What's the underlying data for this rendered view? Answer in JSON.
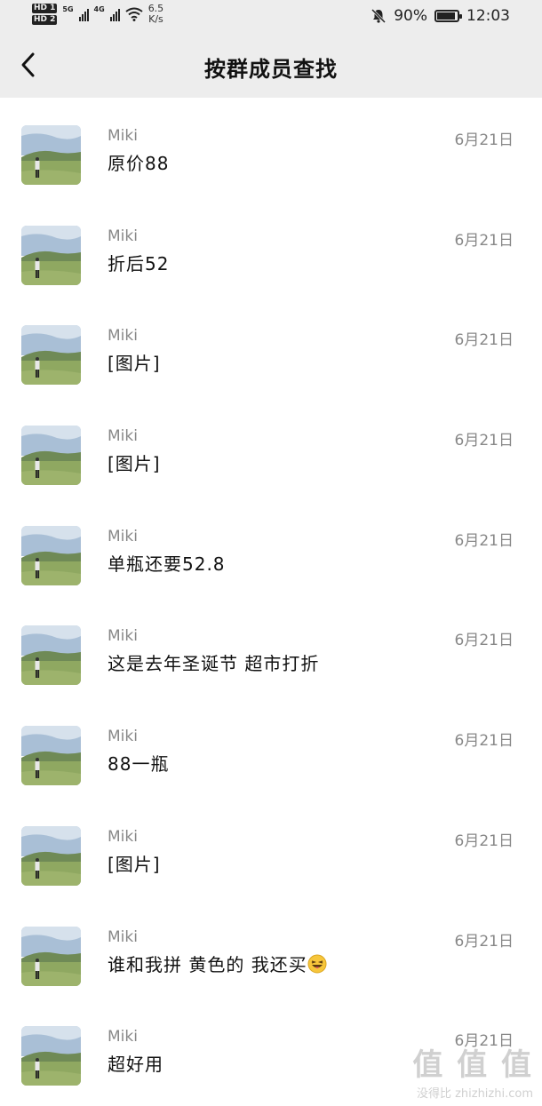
{
  "status_bar": {
    "hd1": "HD 1",
    "hd2": "HD 2",
    "net1": "5G",
    "net2": "4G",
    "speed_value": "6.5",
    "speed_unit": "K/s",
    "battery": "90%",
    "time": "12:03",
    "battery_level": 0.9
  },
  "header": {
    "title": "按群成员查找",
    "back_icon": "chevron-left-icon"
  },
  "results": [
    {
      "name": "Miki",
      "date": "6月21日",
      "message": "原价88"
    },
    {
      "name": "Miki",
      "date": "6月21日",
      "message": "折后52"
    },
    {
      "name": "Miki",
      "date": "6月21日",
      "message": "[图片]"
    },
    {
      "name": "Miki",
      "date": "6月21日",
      "message": "[图片]"
    },
    {
      "name": "Miki",
      "date": "6月21日",
      "message": "单瓶还要52.8"
    },
    {
      "name": "Miki",
      "date": "6月21日",
      "message": "这是去年圣诞节 超市打折"
    },
    {
      "name": "Miki",
      "date": "6月21日",
      "message": "88一瓶"
    },
    {
      "name": "Miki",
      "date": "6月21日",
      "message": "[图片]"
    },
    {
      "name": "Miki",
      "date": "6月21日",
      "message": "谁和我拼 黄色的 我还买",
      "emoji": "grinning-tongue-emoji"
    },
    {
      "name": "Miki",
      "date": "6月21日",
      "message": "超好用"
    }
  ],
  "watermark": {
    "main": "值 值 值",
    "sub": "没得比 zhizhizhi.com"
  }
}
